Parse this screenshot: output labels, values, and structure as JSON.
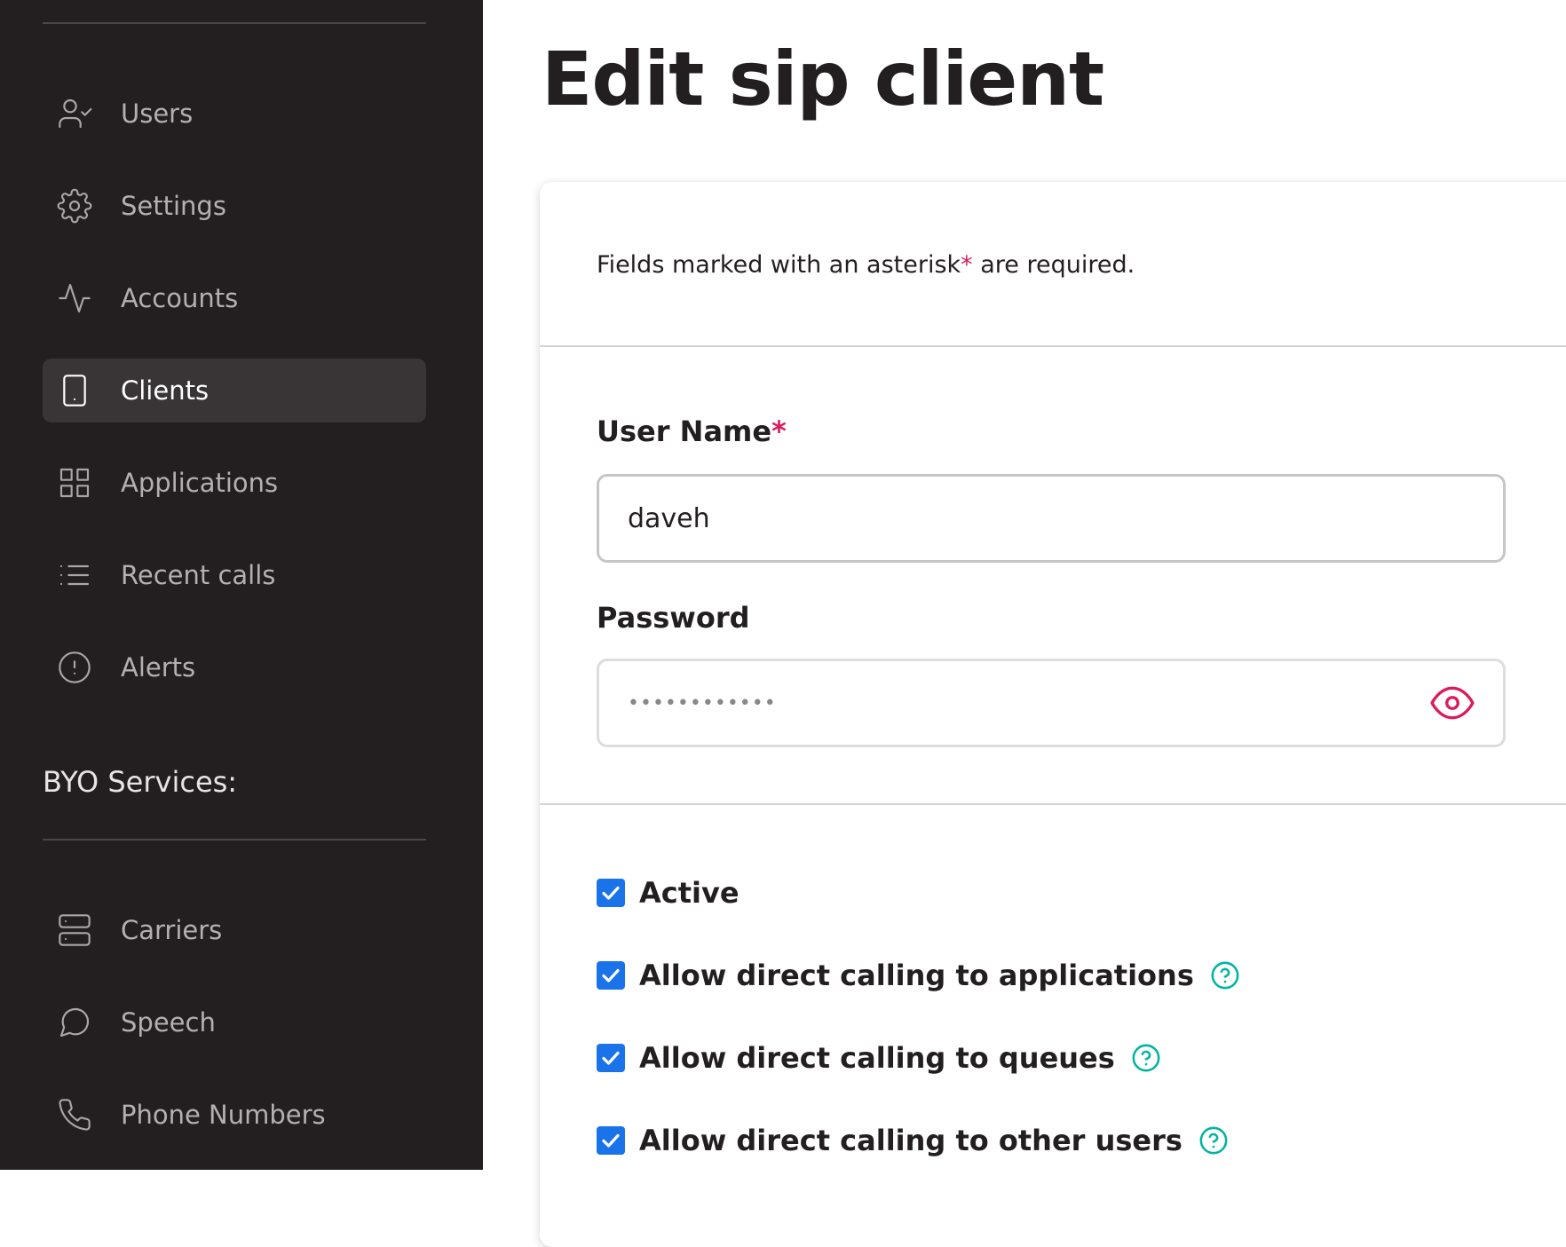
{
  "sidebar": {
    "items": [
      {
        "label": "Users",
        "icon": "user-check-icon"
      },
      {
        "label": "Settings",
        "icon": "gear-icon"
      },
      {
        "label": "Accounts",
        "icon": "activity-icon"
      },
      {
        "label": "Clients",
        "icon": "tablet-icon",
        "active": true
      },
      {
        "label": "Applications",
        "icon": "grid-icon"
      },
      {
        "label": "Recent calls",
        "icon": "list-icon"
      },
      {
        "label": "Alerts",
        "icon": "alert-circle-icon"
      }
    ],
    "section_title": "BYO Services:",
    "byo_items": [
      {
        "label": "Carriers",
        "icon": "server-icon"
      },
      {
        "label": "Speech",
        "icon": "message-circle-icon"
      },
      {
        "label": "Phone Numbers",
        "icon": "phone-icon"
      }
    ]
  },
  "main": {
    "title": "Edit sip client",
    "note_prefix": "Fields marked with an asterisk",
    "note_asterisk": "*",
    "note_suffix": " are required.",
    "username": {
      "label": "User Name",
      "required_mark": "*",
      "value": "daveh"
    },
    "password": {
      "label": "Password",
      "value": "••••••••••••"
    },
    "checkboxes": [
      {
        "label": "Active",
        "checked": true,
        "help": false
      },
      {
        "label": "Allow direct calling to applications",
        "checked": true,
        "help": true
      },
      {
        "label": "Allow direct calling to queues",
        "checked": true,
        "help": true
      },
      {
        "label": "Allow direct calling to other users",
        "checked": true,
        "help": true
      }
    ]
  },
  "colors": {
    "sidebar_bg": "#231f20",
    "active_item_bg": "#393536",
    "accent_pink": "#da1c5c",
    "checkbox_blue": "#1a73e8",
    "help_teal": "#00b4a0"
  }
}
